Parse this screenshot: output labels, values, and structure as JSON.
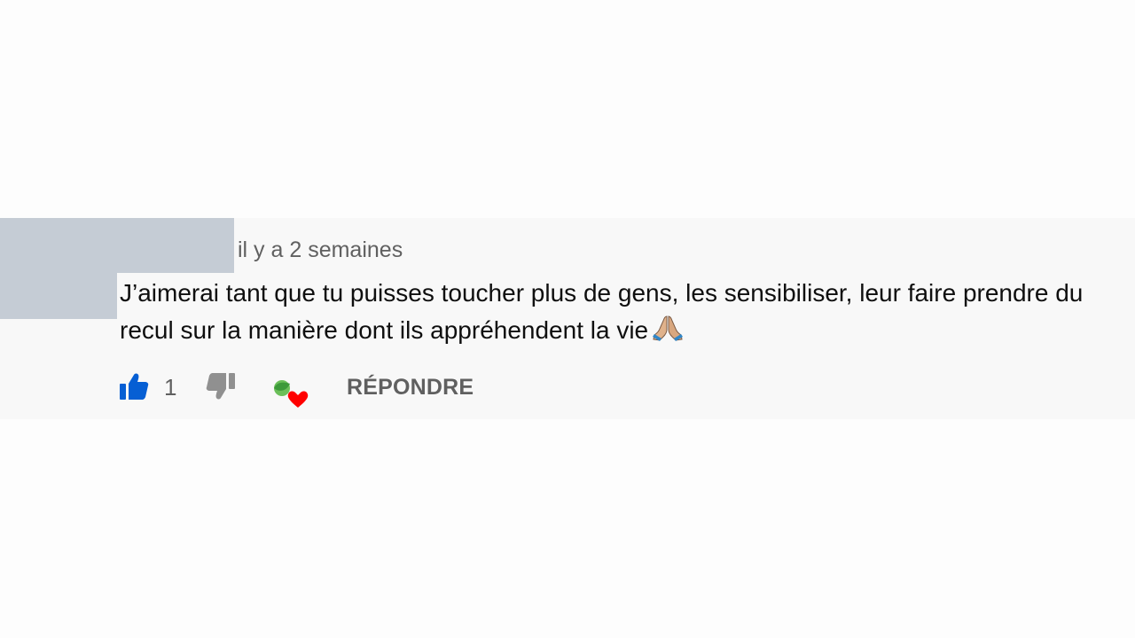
{
  "comment": {
    "timestamp": "il y a 2 semaines",
    "text": "J’aimerai tant que tu puisses toucher plus de gens, les sensibiliser, leur faire prendre du recul sur la manière dont ils appréhendent la vie",
    "emoji": "folded-hands-icon"
  },
  "actions": {
    "like_count": "1",
    "reply_label": "RÉPONDRE",
    "like_icon": "thumb-up-icon",
    "dislike_icon": "thumb-down-icon",
    "heart_icon": "creator-heart-icon"
  },
  "colors": {
    "like_active": "#065fd4",
    "dislike": "#909090",
    "heart": "#ff0000",
    "secondary_text": "#606060",
    "comment_background": "#f8f8f8",
    "redaction": "#c5ccd5"
  }
}
